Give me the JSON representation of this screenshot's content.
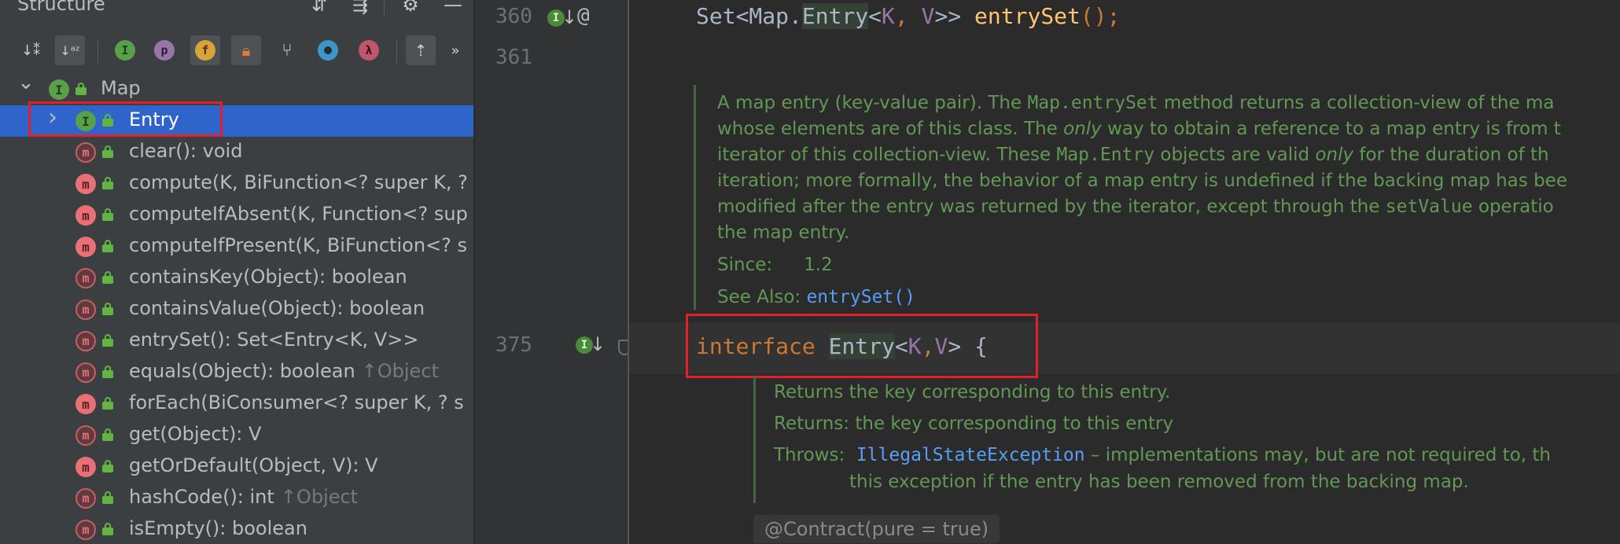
{
  "structure_panel": {
    "title": "Structure",
    "toolbar": {
      "inherited_label": "I",
      "properties_label": "p",
      "fields_label": "f",
      "lambdas_label": "λ",
      "more_label": "»"
    },
    "tree": {
      "root": {
        "label": "Map",
        "icon": "interface-icon"
      },
      "items": [
        {
          "label": "Entry",
          "icon": "interface-icon",
          "selected": true
        },
        {
          "label": "clear(): void",
          "icon": "abstract-method-icon"
        },
        {
          "label": "compute(K, BiFunction<? super K, ?",
          "icon": "method-icon"
        },
        {
          "label": "computeIfAbsent(K, Function<? sup",
          "icon": "method-icon"
        },
        {
          "label": "computeIfPresent(K, BiFunction<? s",
          "icon": "method-icon"
        },
        {
          "label": "containsKey(Object): boolean",
          "icon": "abstract-method-icon"
        },
        {
          "label": "containsValue(Object): boolean",
          "icon": "abstract-method-icon"
        },
        {
          "label": "entrySet(): Set<Entry<K, V>>",
          "icon": "abstract-method-icon"
        },
        {
          "label": "equals(Object): boolean",
          "inherited": "↑Object",
          "icon": "abstract-method-icon"
        },
        {
          "label": "forEach(BiConsumer<? super K, ? s",
          "icon": "method-icon"
        },
        {
          "label": "get(Object): V",
          "icon": "abstract-method-icon"
        },
        {
          "label": "getOrDefault(Object, V): V",
          "icon": "method-icon"
        },
        {
          "label": "hashCode(): int",
          "inherited": "↑Object",
          "icon": "abstract-method-icon"
        },
        {
          "label": "isEmpty(): boolean",
          "icon": "abstract-method-icon"
        }
      ]
    }
  },
  "editor": {
    "gutter": {
      "line_360": "360",
      "line_361": "361",
      "line_375": "375",
      "at_marker": "@"
    },
    "code": {
      "line_360": {
        "type_prefix": "Set<Map.",
        "entry": "Entry",
        "lt": "<",
        "k": "K",
        "comma": ", ",
        "v": "V",
        "gt": ">> ",
        "method": "entrySet",
        "suffix": "();"
      },
      "line_375": {
        "keyword": "interface",
        "space": " ",
        "name": "Entry",
        "lt": "<",
        "k": "K",
        "comma": ",",
        "v": "V",
        "rest": "> {"
      }
    },
    "doc_entry": {
      "lines": [
        [
          "A map entry (key-value pair). The ",
          "Map.entrySet",
          " method returns a collection-view of the ma"
        ],
        [
          "whose elements are of this class. The ",
          "only",
          " way to obtain a reference to a map entry is from t"
        ],
        [
          "iterator of this collection-view. These ",
          "Map.Entry",
          " objects are valid ",
          "only",
          " for the duration of th"
        ],
        [
          "iteration; more formally, the behavior of a map entry is undefined if the backing map has bee"
        ],
        [
          "modified after the entry was returned by the iterator, except through the ",
          "setValue",
          " operatio"
        ],
        [
          "the map entry."
        ]
      ],
      "since_label": "Since:",
      "since_value": "1.2",
      "see_also_label": "See Also:",
      "see_also_link": "entrySet()"
    },
    "doc_getkey": {
      "summary": "Returns the key corresponding to this entry.",
      "returns_label": "Returns:",
      "returns_value": "the key corresponding to this entry",
      "throws_label": "Throws:",
      "throws_link": "IllegalStateException",
      "throws_text_1": " – implementations may, but are not required to, th",
      "throws_text_2": "this exception if the entry has been removed from the backing map."
    },
    "annotation": "@Contract(pure = true)"
  },
  "colors": {
    "panel_bg": "#3c3f41",
    "editor_bg": "#2b2b2b",
    "selection": "#2f65ca",
    "highlight_box": "#e2202a",
    "doc_text": "#629755",
    "keyword": "#cc7832",
    "method_name": "#ffc66d",
    "type_param": "#9876aa",
    "link": "#589df6"
  }
}
